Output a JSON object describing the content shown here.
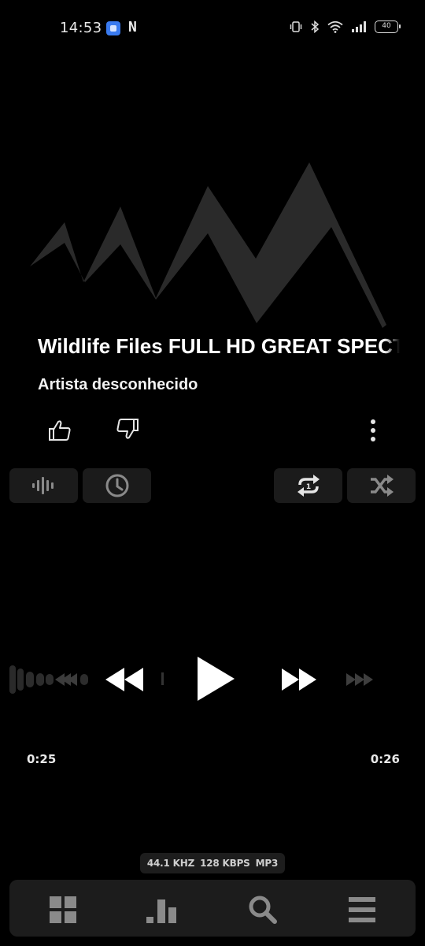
{
  "status_bar": {
    "time": "14:53",
    "notification_letter": "N",
    "battery_level": "40",
    "icons": [
      "vibrate-icon",
      "bluetooth-icon",
      "wifi-icon",
      "signal-icon",
      "battery-icon"
    ]
  },
  "track": {
    "title": "Wildlife Files FULL HD GREAT SPECTACLE",
    "artist": "Artista desconhecido"
  },
  "playback": {
    "current_time": "0:25",
    "total_time": "0:26",
    "state": "paused"
  },
  "audio_format": {
    "sample_rate": "44.1 KHZ",
    "bitrate": "128 KBPS",
    "codec": "MP3"
  },
  "tools": [
    "equalizer-icon",
    "sleep-timer-icon",
    "repeat-one-icon",
    "shuffle-icon"
  ],
  "nav": [
    "library-icon",
    "stats-icon",
    "search-icon",
    "queue-icon"
  ],
  "colors": {
    "background": "#000000",
    "surface": "#1c1c1c",
    "art": "#2a2a2a",
    "icon_dim": "#8a8a8a",
    "text": "#ffffff"
  }
}
